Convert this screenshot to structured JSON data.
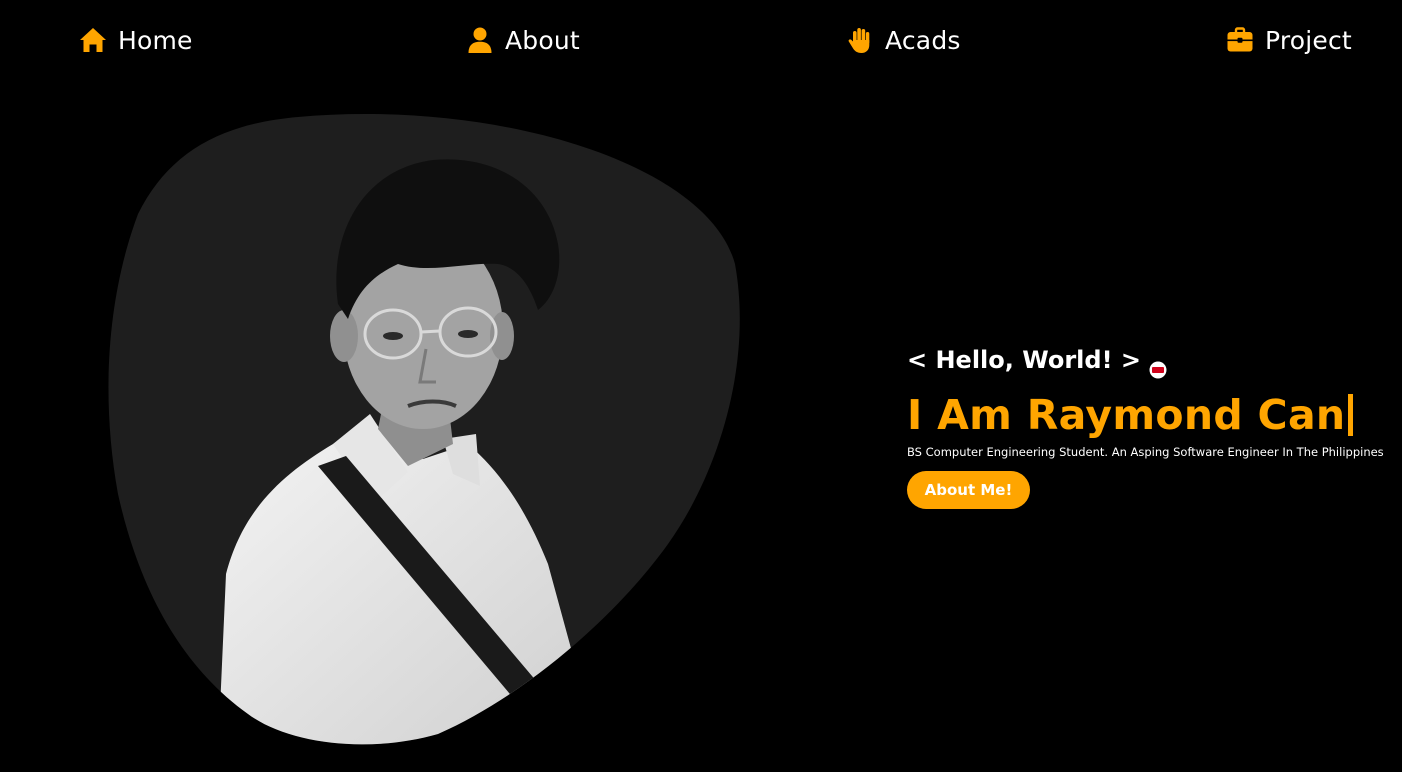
{
  "nav": {
    "items": [
      {
        "label": "Home",
        "icon": "home-icon"
      },
      {
        "label": "About",
        "icon": "user-icon"
      },
      {
        "label": "Acads",
        "icon": "hand-icon"
      },
      {
        "label": "Project",
        "icon": "briefcase-icon"
      }
    ]
  },
  "hero": {
    "greeting": "< Hello, World! >",
    "greeting_icon": "flag-icon",
    "headline": "I Am Raymond Can",
    "subtitle": "BS Computer Engineering Student. An Asping Software Engineer In The Philippines",
    "cta_label": "About Me!",
    "photo": "profile-photo"
  },
  "colors": {
    "background": "#000000",
    "accent": "#ffa500",
    "blob": "#1e1e1e",
    "text": "#ffffff"
  }
}
